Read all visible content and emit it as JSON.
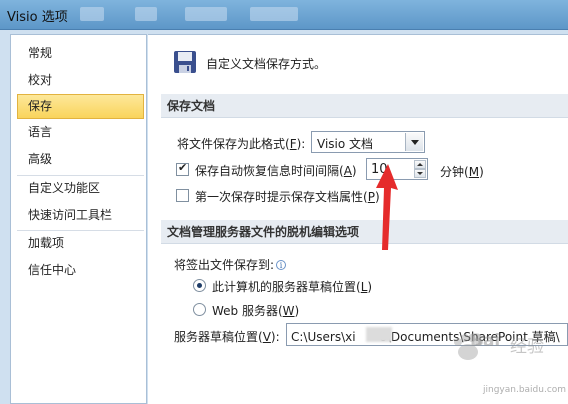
{
  "window": {
    "title": "Visio 选项"
  },
  "sidebar": {
    "items": [
      {
        "label": "常规"
      },
      {
        "label": "校对"
      },
      {
        "label": "保存",
        "selected": true
      },
      {
        "label": "语言"
      },
      {
        "label": "高级"
      },
      {
        "label": "自定义功能区"
      },
      {
        "label": "快速访问工具栏"
      },
      {
        "label": "加载项"
      },
      {
        "label": "信任中心"
      }
    ]
  },
  "main": {
    "header": "自定义文档保存方式。",
    "save_section": {
      "title": "保存文档",
      "format_label": "将文件保存为此格式",
      "format_key": "F",
      "format_value": "Visio 文档",
      "autorecover_label": "保存自动恢复信息时间间隔",
      "autorecover_key": "A",
      "autorecover_checked": true,
      "autorecover_value": "10",
      "minutes_label": "分钟",
      "minutes_key": "M",
      "prompt_label": "第一次保存时提示保存文档属性",
      "prompt_key": "P",
      "prompt_checked": false
    },
    "offline_section": {
      "title": "文档管理服务器文件的脱机编辑选项",
      "checkout_label": "将签出文件保存到:",
      "option_local": "此计算机的服务器草稿位置",
      "option_local_key": "L",
      "option_local_checked": true,
      "option_web": "Web 服务器",
      "option_web_key": "W",
      "option_web_checked": false,
      "drafts_label": "服务器草稿位置",
      "drafts_key": "V",
      "drafts_value_pre": "C:\\Users\\xi",
      "drafts_value_post": "o\\Documents\\SharePoint 草稿\\"
    }
  },
  "watermark": {
    "text": "Bai",
    "cn": "经验",
    "url": "jingyan.baidu.com"
  },
  "colors": {
    "selected_bg": "#f9d45c",
    "titlebar": "#6fa6d3",
    "annotation": "#e52b2b"
  }
}
